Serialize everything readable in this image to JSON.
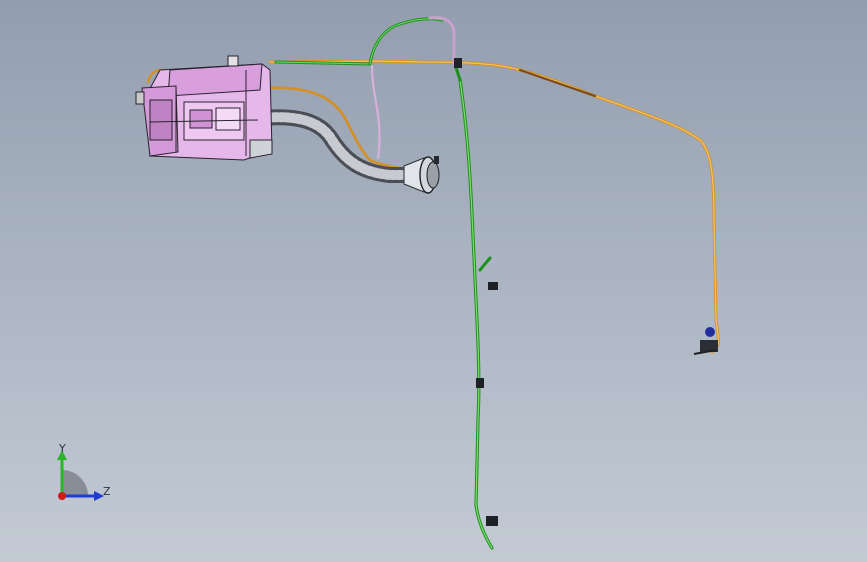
{
  "viewport": {
    "background_top": "#929dae",
    "background_bottom": "#c3cad4"
  },
  "colors": {
    "harness_green": "#2fae2a",
    "harness_orange": "#e9a33a",
    "reservoir_pink": "#e6b8ea",
    "hose_gray": "#6d7177",
    "connector_dark": "#1e2226"
  },
  "triad": {
    "y_label": "Y",
    "z_label": "Z",
    "y_color": "#2bb52b",
    "z_color": "#1f3bd6",
    "origin_color": "#d11b1b"
  },
  "parts": [
    {
      "name": "washer-reservoir",
      "type": "tank"
    },
    {
      "name": "corrugated-hose",
      "type": "hose"
    },
    {
      "name": "filler-neck",
      "type": "fitting"
    },
    {
      "name": "green-harness",
      "type": "wire"
    },
    {
      "name": "orange-harness",
      "type": "wire"
    },
    {
      "name": "nozzle-connector",
      "type": "connector"
    }
  ]
}
